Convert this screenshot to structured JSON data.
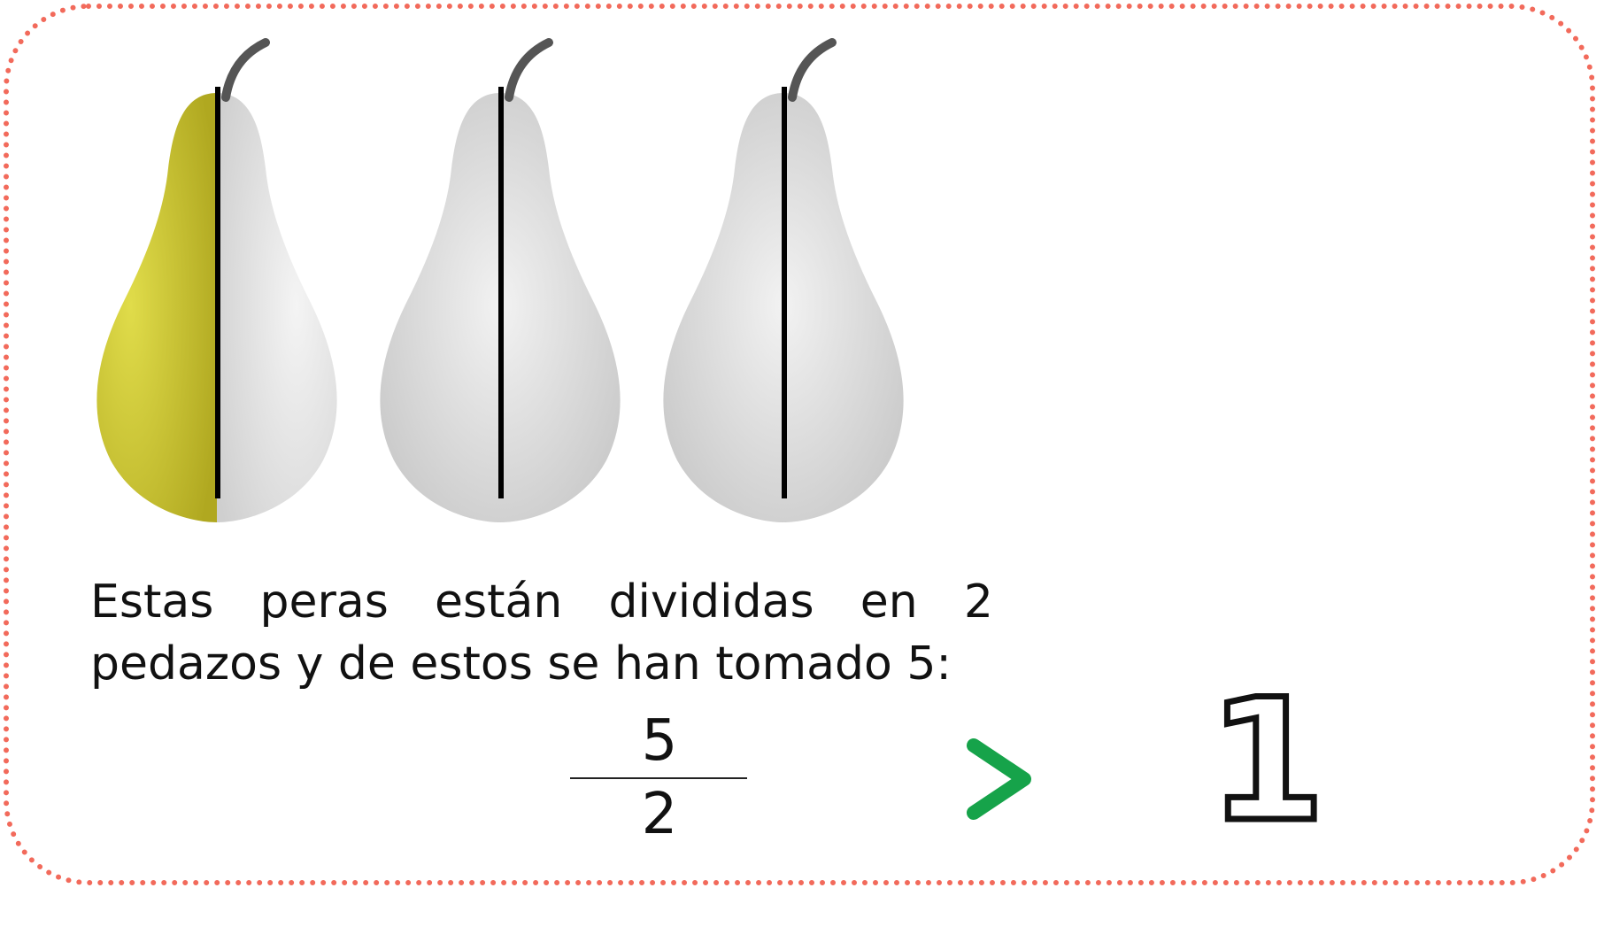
{
  "colors": {
    "border": "#f26a5b",
    "pear_yellow": "#c9c62a",
    "pear_gray": "#d6d6d6",
    "divider": "#000000",
    "comparison": "#16a34a"
  },
  "pears": [
    {
      "left_half": "yellow",
      "right_half": "gray"
    },
    {
      "left_half": "gray",
      "right_half": "gray"
    },
    {
      "left_half": "gray",
      "right_half": "gray"
    }
  ],
  "text": {
    "line1": "Estas peras están divididas en 2",
    "line2": "pedazos y de estos se han tomado 5:"
  },
  "fraction": {
    "numerator": "5",
    "denominator": "2"
  },
  "comparison": {
    "symbol": ">",
    "icon": "greater-than-icon",
    "right_value": "1"
  }
}
